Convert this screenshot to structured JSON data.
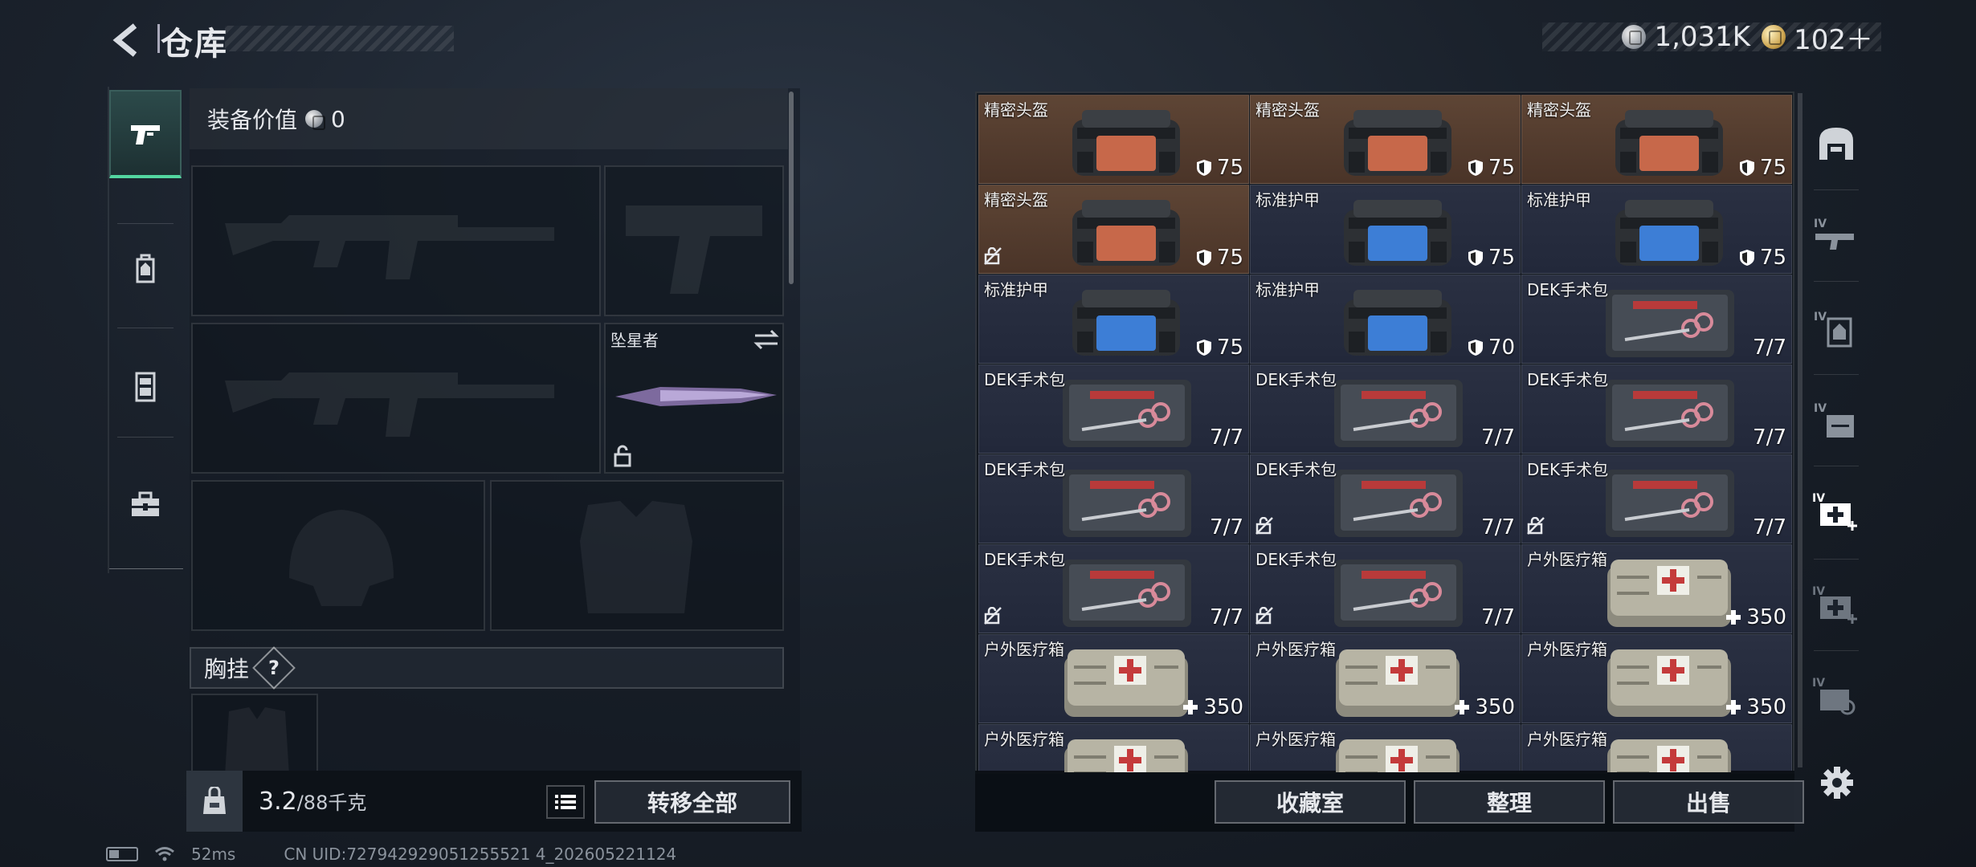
{
  "header": {
    "title": "仓库",
    "currency_silver": "1,031K",
    "currency_gold": "102＋"
  },
  "loadout": {
    "value_label": "装备价值",
    "value": "0",
    "melee_name": "坠星者",
    "chest_label": "胸挂",
    "chest_help": "?",
    "weight": "3.2",
    "weight_max": "/88千克",
    "transfer_all": "转移全部"
  },
  "storage": {
    "items": [
      {
        "name": "精密头盔",
        "value": "75",
        "kind": "armor",
        "rarity": "gold",
        "icon": "shield-icon",
        "lock": false
      },
      {
        "name": "精密头盔",
        "value": "75",
        "kind": "armor",
        "rarity": "gold",
        "icon": "shield-icon",
        "lock": false
      },
      {
        "name": "精密头盔",
        "value": "75",
        "kind": "armor",
        "rarity": "gold",
        "icon": "shield-icon",
        "lock": false
      },
      {
        "name": "精密头盔",
        "value": "75",
        "kind": "armor",
        "rarity": "gold",
        "icon": "shield-icon",
        "lock": true
      },
      {
        "name": "标准护甲",
        "value": "75",
        "kind": "vest",
        "rarity": "blue",
        "icon": "shield-icon",
        "lock": false
      },
      {
        "name": "标准护甲",
        "value": "75",
        "kind": "vest",
        "rarity": "blue",
        "icon": "shield-icon",
        "lock": false
      },
      {
        "name": "标准护甲",
        "value": "75",
        "kind": "vest",
        "rarity": "blue",
        "icon": "shield-icon",
        "lock": false
      },
      {
        "name": "标准护甲",
        "value": "70",
        "kind": "vest",
        "rarity": "blue",
        "icon": "shield-icon",
        "lock": false
      },
      {
        "name": "DEK手术包",
        "value": "7/7",
        "kind": "kit",
        "rarity": "blue",
        "icon": "",
        "lock": false
      },
      {
        "name": "DEK手术包",
        "value": "7/7",
        "kind": "kit",
        "rarity": "blue",
        "icon": "",
        "lock": false
      },
      {
        "name": "DEK手术包",
        "value": "7/7",
        "kind": "kit",
        "rarity": "blue",
        "icon": "",
        "lock": false
      },
      {
        "name": "DEK手术包",
        "value": "7/7",
        "kind": "kit",
        "rarity": "blue",
        "icon": "",
        "lock": false
      },
      {
        "name": "DEK手术包",
        "value": "7/7",
        "kind": "kit",
        "rarity": "blue",
        "icon": "",
        "lock": false
      },
      {
        "name": "DEK手术包",
        "value": "7/7",
        "kind": "kit",
        "rarity": "blue",
        "icon": "",
        "lock": true
      },
      {
        "name": "DEK手术包",
        "value": "7/7",
        "kind": "kit",
        "rarity": "blue",
        "icon": "",
        "lock": true
      },
      {
        "name": "DEK手术包",
        "value": "7/7",
        "kind": "kit",
        "rarity": "blue",
        "icon": "",
        "lock": true
      },
      {
        "name": "DEK手术包",
        "value": "7/7",
        "kind": "kit",
        "rarity": "blue",
        "icon": "",
        "lock": true
      },
      {
        "name": "户外医疗箱",
        "value": "350",
        "kind": "med",
        "rarity": "blue",
        "icon": "plus-icon",
        "lock": false
      },
      {
        "name": "户外医疗箱",
        "value": "350",
        "kind": "med",
        "rarity": "blue",
        "icon": "plus-icon",
        "lock": false
      },
      {
        "name": "户外医疗箱",
        "value": "350",
        "kind": "med",
        "rarity": "blue",
        "icon": "plus-icon",
        "lock": false
      },
      {
        "name": "户外医疗箱",
        "value": "350",
        "kind": "med",
        "rarity": "blue",
        "icon": "plus-icon",
        "lock": false
      },
      {
        "name": "户外医疗箱",
        "value": "",
        "kind": "med",
        "rarity": "blue",
        "icon": "",
        "lock": false
      },
      {
        "name": "户外医疗箱",
        "value": "",
        "kind": "med",
        "rarity": "blue",
        "icon": "",
        "lock": false
      },
      {
        "name": "户外医疗箱",
        "value": "",
        "kind": "med",
        "rarity": "blue",
        "icon": "",
        "lock": false
      }
    ],
    "buttons": {
      "collection": "收藏室",
      "organize": "整理",
      "sell": "出售"
    }
  },
  "footer": {
    "ping": "52ms",
    "uid": "CN UID:727942929051255521 4_202605221124"
  },
  "colors": {
    "accent": "#53d6a0",
    "gold_cell": "#5e4535",
    "blue_cell": "#2a3042"
  }
}
